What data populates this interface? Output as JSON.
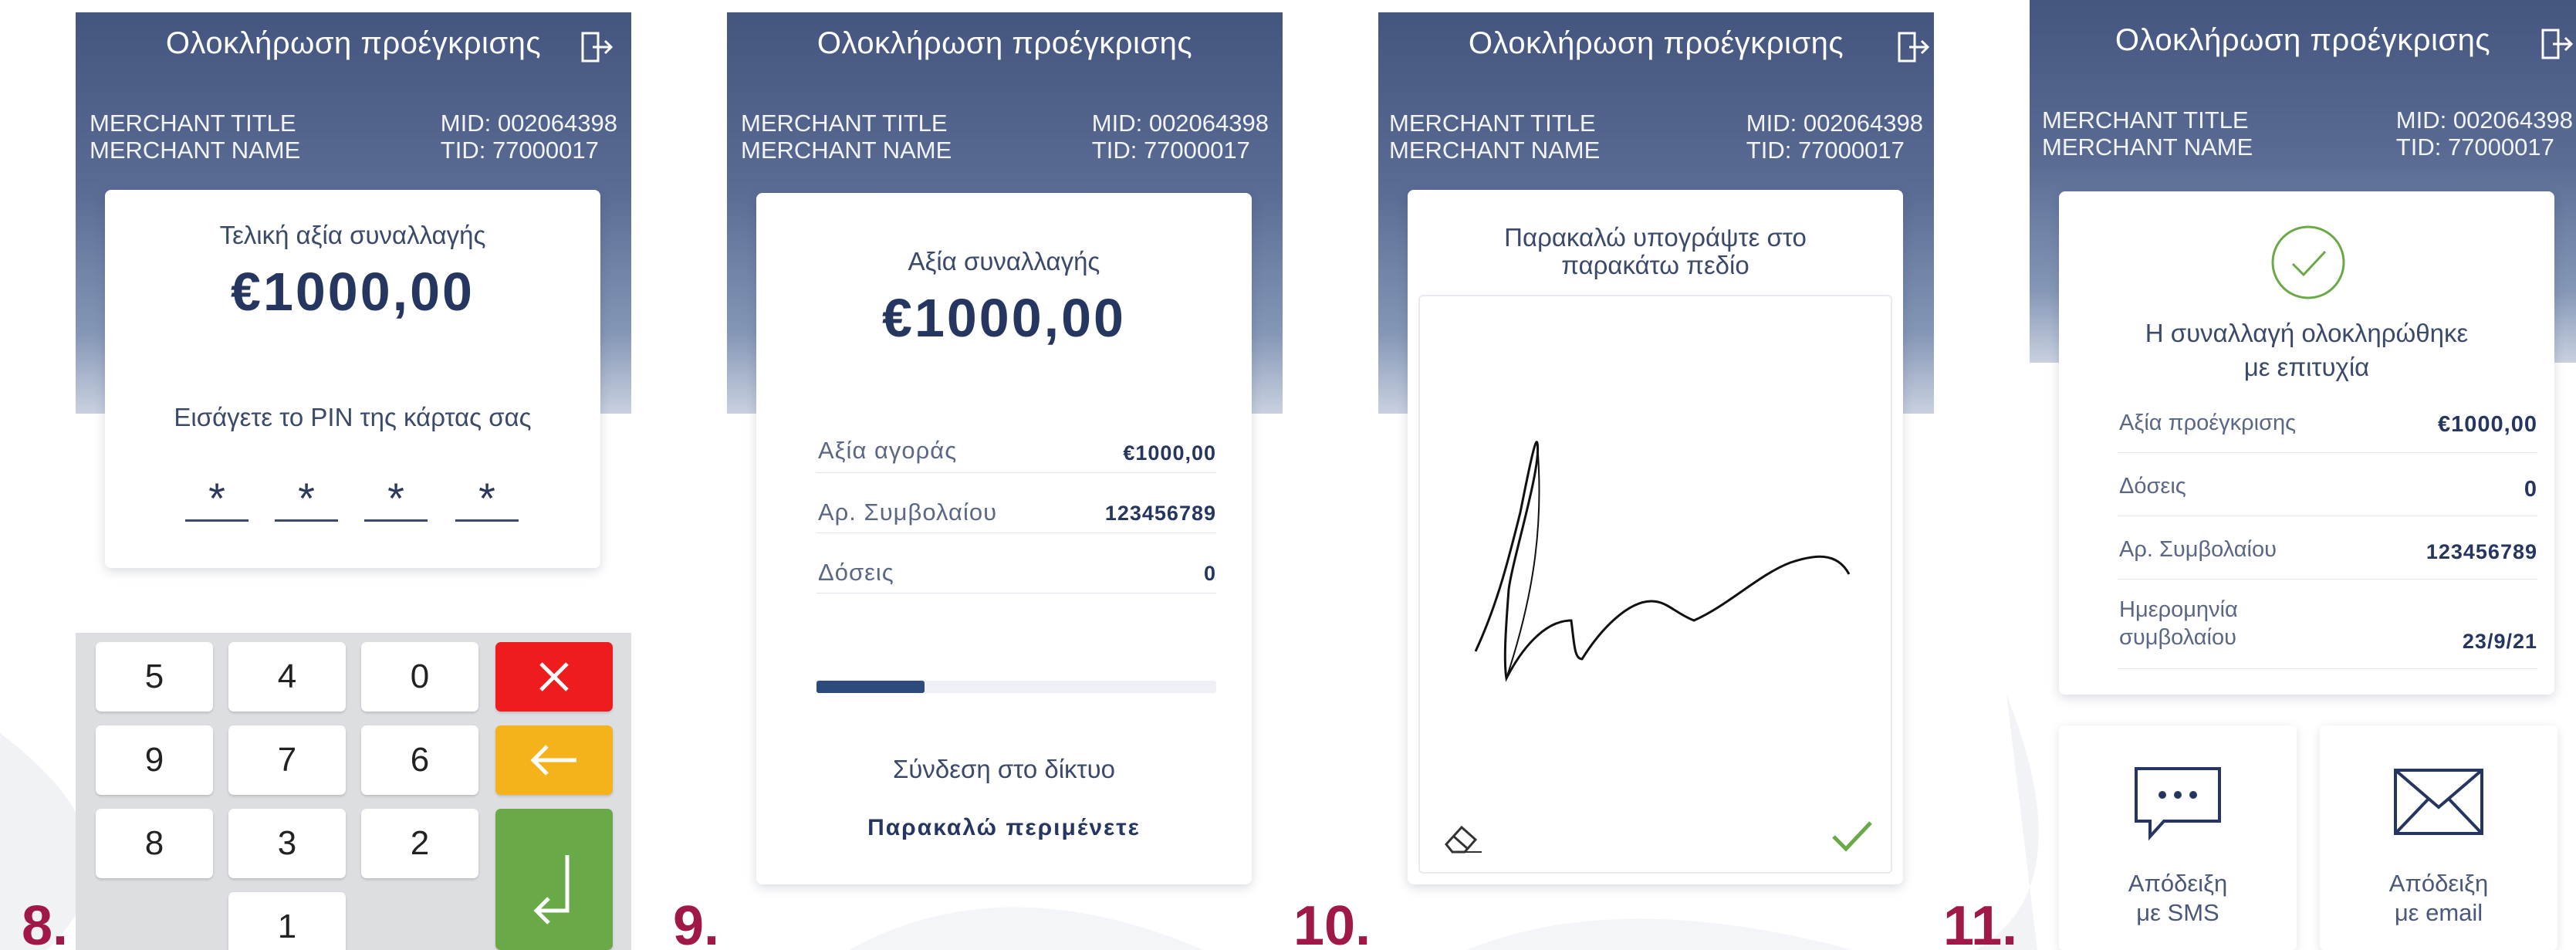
{
  "header": {
    "title": "Ολοκλήρωση προέγκρισης",
    "merchant_title": "MERCHANT TITLE",
    "merchant_name": "MERCHANT NAME",
    "mid": "MID: 002064398",
    "tid": "TID: 77000017"
  },
  "step_numbers": [
    "8.",
    "9.",
    "10.",
    "11."
  ],
  "screen8": {
    "amount_label": "Τελική αξία συναλλαγής",
    "amount": "€1000,00",
    "pin_prompt": "Εισάγετε το PIN της κάρτας σας",
    "pin_chars": [
      "*",
      "*",
      "*",
      "*"
    ],
    "keys": {
      "k5": "5",
      "k4": "4",
      "k0": "0",
      "k9": "9",
      "k7": "7",
      "k6": "6",
      "k8": "8",
      "k3": "3",
      "k2": "2",
      "k1": "1"
    },
    "colors": {
      "cancel": "#ee1c1c",
      "clear": "#f5b21b",
      "enter": "#6aa947"
    }
  },
  "screen9": {
    "amount_label": "Αξία συναλλαγής",
    "amount": "€1000,00",
    "rows": [
      {
        "label": "Αξία αγοράς",
        "value": "€1000,00"
      },
      {
        "label": "Αρ. Συμβολαίου",
        "value": "123456789"
      },
      {
        "label": "Δόσεις",
        "value": "0"
      }
    ],
    "progress": 0.27,
    "status": "Σύνδεση στο δίκτυο",
    "wait": "Παρακαλώ περιμένετε"
  },
  "screen10": {
    "prompt": "Παρακαλώ υπογράψτε στο\nπαρακάτω πεδίο",
    "clear_icon": "eraser-icon",
    "confirm_icon": "checkmark-icon"
  },
  "screen11": {
    "success": "Η συναλλαγή ολοκληρώθηκε\nμε επιτυχία",
    "rows": [
      {
        "label": "Αξία προέγκρισης",
        "value": "€1000,00"
      },
      {
        "label": "Δόσεις",
        "value": "0"
      },
      {
        "label": "Αρ. Συμβολαίου",
        "value": "123456789"
      },
      {
        "label": "Ημερομηνία\nσυμβολαίου",
        "value": "23/9/21"
      }
    ],
    "sms_label": "Απόδειξη\nμε SMS",
    "email_label": "Απόδειξη\nμε email"
  }
}
